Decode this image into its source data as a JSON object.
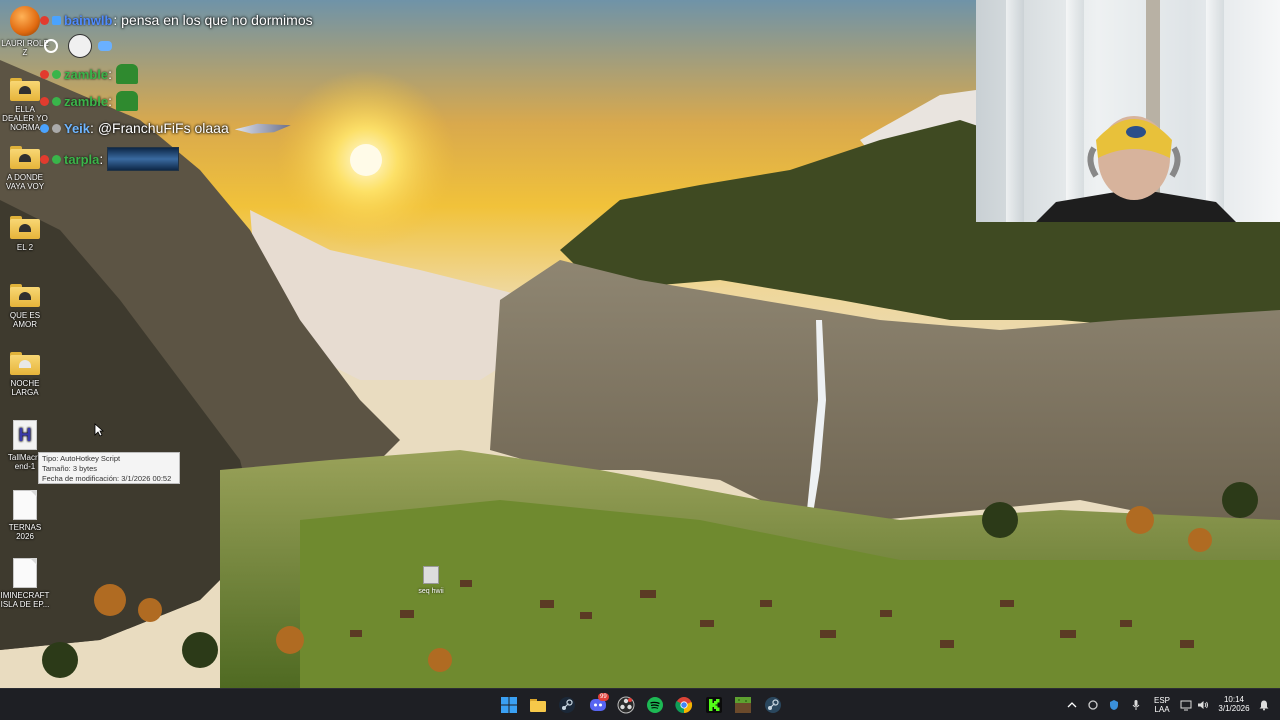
{
  "desktop_icons": [
    {
      "label": "LAURI ROLE Z",
      "kind": "app"
    },
    {
      "label": "ELLA DEALER YO NORMA",
      "kind": "folder"
    },
    {
      "label": "A DONDE VAYA VOY",
      "kind": "folder"
    },
    {
      "label": "EL 2",
      "kind": "folder"
    },
    {
      "label": "QUE ES AMOR",
      "kind": "folder"
    },
    {
      "label": "NOCHE LARGA",
      "kind": "folder"
    },
    {
      "label": "TallMacro end-1",
      "kind": "ahk"
    },
    {
      "label": "TERNAS 2026",
      "kind": "file"
    },
    {
      "label": "IMINECRAFT ISLA DE EP...",
      "kind": "file"
    }
  ],
  "chat": [
    {
      "user": "bainwlb",
      "message": "pensa en los que no dormimos"
    },
    {
      "user": "zamble",
      "message": ""
    },
    {
      "user": "zamble",
      "message": ""
    },
    {
      "user": "Yeik",
      "message": "@FranchuFiFs olaaa"
    },
    {
      "user": "tarpla",
      "message": ""
    }
  ],
  "tooltip": {
    "line1": "Tipo: AutoHotkey Script",
    "line2": "Tamaño: 3 bytes",
    "line3": "Fecha de modificación: 3/1/2026 00:52"
  },
  "desktop_file_label": "seq hwii",
  "taskbar": {
    "pinned": [
      "start-icon",
      "file-explorer-icon",
      "steam-icon",
      "discord-icon",
      "obs-icon",
      "spotify-icon",
      "chrome-icon",
      "kick-icon",
      "minecraft-icon",
      "steam-alt-icon"
    ],
    "discord_badge": "99",
    "language_line1": "ESP",
    "language_line2": "LAA",
    "time": "10:14",
    "date": "3/1/2026"
  },
  "colors": {
    "taskbar_bg": "#1e1f24",
    "chat_user_blue": "#4f8bff",
    "chat_user_green": "#3bb54a",
    "spotify": "#1db954",
    "kick": "#53fc18"
  }
}
